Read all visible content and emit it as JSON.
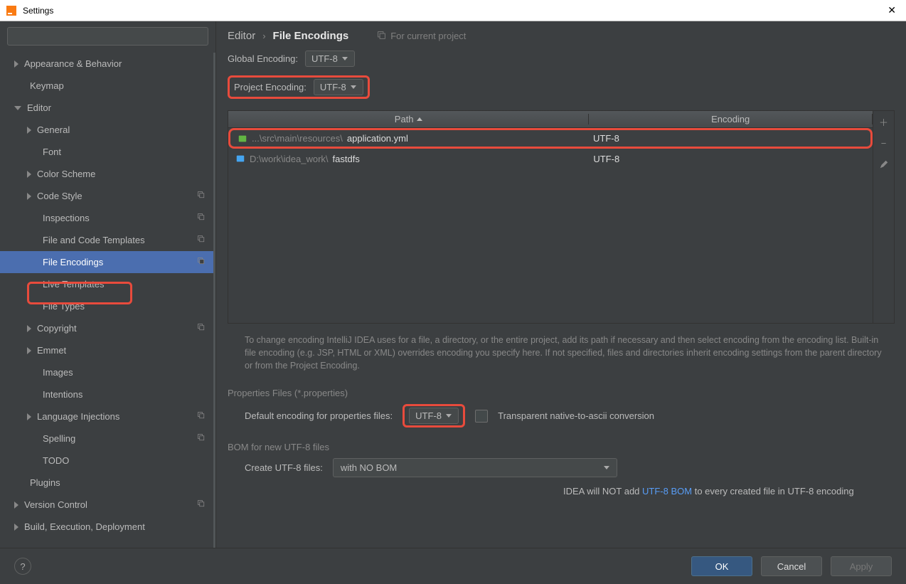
{
  "window": {
    "title": "Settings"
  },
  "breadcrumb": {
    "parent": "Editor",
    "current": "File Encodings",
    "for_project": "For current project"
  },
  "sidebar": {
    "items": [
      {
        "label": "Appearance & Behavior",
        "arrow": "right",
        "lvl": 0
      },
      {
        "label": "Keymap",
        "arrow": "none",
        "lvl": 0
      },
      {
        "label": "Editor",
        "arrow": "down",
        "lvl": 0
      },
      {
        "label": "General",
        "arrow": "right",
        "lvl": 1
      },
      {
        "label": "Font",
        "arrow": "none",
        "lvl": 1
      },
      {
        "label": "Color Scheme",
        "arrow": "right",
        "lvl": 1
      },
      {
        "label": "Code Style",
        "arrow": "right",
        "lvl": 1,
        "badge": true
      },
      {
        "label": "Inspections",
        "arrow": "none",
        "lvl": 1,
        "badge": true
      },
      {
        "label": "File and Code Templates",
        "arrow": "none",
        "lvl": 1,
        "badge": true
      },
      {
        "label": "File Encodings",
        "arrow": "none",
        "lvl": 1,
        "badge": true,
        "selected": true
      },
      {
        "label": "Live Templates",
        "arrow": "none",
        "lvl": 1
      },
      {
        "label": "File Types",
        "arrow": "none",
        "lvl": 1
      },
      {
        "label": "Copyright",
        "arrow": "right",
        "lvl": 1,
        "badge": true
      },
      {
        "label": "Emmet",
        "arrow": "right",
        "lvl": 1
      },
      {
        "label": "Images",
        "arrow": "none",
        "lvl": 1
      },
      {
        "label": "Intentions",
        "arrow": "none",
        "lvl": 1
      },
      {
        "label": "Language Injections",
        "arrow": "right",
        "lvl": 1,
        "badge": true
      },
      {
        "label": "Spelling",
        "arrow": "none",
        "lvl": 1,
        "badge": true
      },
      {
        "label": "TODO",
        "arrow": "none",
        "lvl": 1
      },
      {
        "label": "Plugins",
        "arrow": "none",
        "lvl": 0
      },
      {
        "label": "Version Control",
        "arrow": "right",
        "lvl": 0,
        "badge": true
      },
      {
        "label": "Build, Execution, Deployment",
        "arrow": "right",
        "lvl": 0
      }
    ]
  },
  "encoding": {
    "global_label": "Global Encoding:",
    "global_value": "UTF-8",
    "project_label": "Project Encoding:",
    "project_value": "UTF-8"
  },
  "table": {
    "col_path": "Path",
    "col_enc": "Encoding",
    "rows": [
      {
        "prefix": "...\\src\\main\\resources\\",
        "tail": "application.yml",
        "encoding": "UTF-8",
        "icon": "leaf"
      },
      {
        "prefix": "D:\\work\\idea_work\\",
        "tail": "fastdfs",
        "encoding": "UTF-8",
        "icon": "folder"
      }
    ]
  },
  "help": "To change encoding IntelliJ IDEA uses for a file, a directory, or the entire project, add its path if necessary and then select encoding from the encoding list. Built-in file encoding (e.g. JSP, HTML or XML) overrides encoding you specify here. If not specified, files and directories inherit encoding settings from the parent directory or from the Project Encoding.",
  "properties": {
    "section": "Properties Files (*.properties)",
    "default_label": "Default encoding for properties files:",
    "default_value": "UTF-8",
    "checkbox_label": "Transparent native-to-ascii conversion"
  },
  "bom": {
    "section": "BOM for new UTF-8 files",
    "create_label": "Create UTF-8 files:",
    "create_value": "with NO BOM",
    "note_pre": "IDEA will NOT add ",
    "note_link": "UTF-8 BOM",
    "note_post": " to every created file in UTF-8 encoding"
  },
  "buttons": {
    "ok": "OK",
    "cancel": "Cancel",
    "apply": "Apply"
  }
}
